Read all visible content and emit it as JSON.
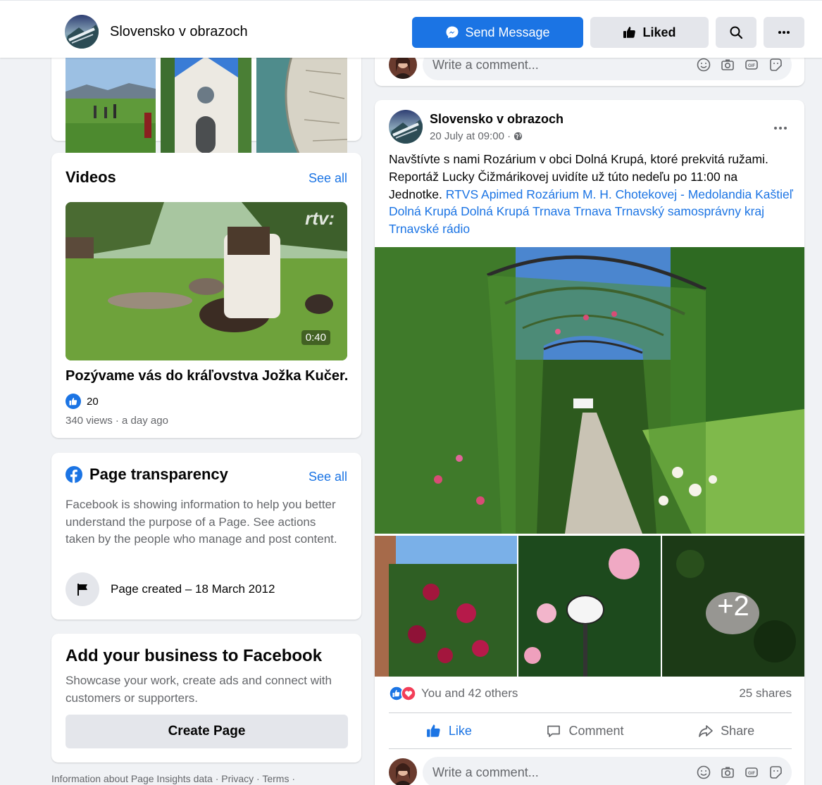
{
  "header": {
    "page_name": "Slovensko v obrazoch",
    "send_message_label": "Send Message",
    "liked_label": "Liked"
  },
  "videos": {
    "title": "Videos",
    "see_all": "See all",
    "video": {
      "duration": "0:40",
      "watermark": "rtv:",
      "title": "Pozývame vás do kráľovstva Jožka Kučer...",
      "likes": "20",
      "meta": "340 views · a day ago"
    }
  },
  "transparency": {
    "title": "Page transparency",
    "see_all": "See all",
    "description": "Facebook is showing information to help you better understand the purpose of a Page. See actions taken by the people who manage and post content.",
    "created": "Page created – 18 March 2012"
  },
  "business": {
    "title": "Add your business to Facebook",
    "description": "Showcase your work, create ads and connect with customers or supporters.",
    "button": "Create Page"
  },
  "footer": {
    "links": "Information about Page Insights data · Privacy · Terms ·"
  },
  "comment_placeholder": "Write a comment...",
  "post": {
    "author": "Slovensko v obrazoch",
    "date": "20 July at 09:00 ·",
    "text_plain": "Navštívte s nami Rozárium v obci Dolná Krupá, ktoré prekvitá ružami. Reportáž Lucky Čižmárikovej uvidíte už túto nedeľu po 11:00 na Jednotke.",
    "text_links": "RTVS Apimed Rozárium M. H. Chotekovej - Medolandia Kaštieľ Dolná Krupá Dolná Krupá Trnava Trnava Trnavský samosprávny kraj Trnavské rádio",
    "more_photos": "+2",
    "reactions": "You and 42 others",
    "shares": "25 shares",
    "like_label": "Like",
    "comment_label": "Comment",
    "share_label": "Share"
  },
  "colors": {
    "accent": "#1b74e4",
    "love": "#f33e58"
  }
}
